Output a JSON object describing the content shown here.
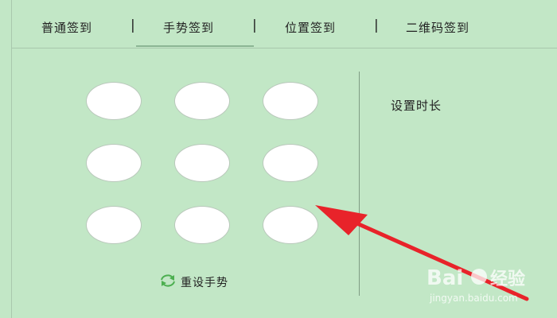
{
  "tabs": [
    {
      "label": "普通签到"
    },
    {
      "label": "手势签到",
      "active": true
    },
    {
      "label": "位置签到"
    },
    {
      "label": "二维码签到"
    }
  ],
  "separator": "|",
  "gesture_panel": {
    "reset_label": "重设手势",
    "reset_icon": "refresh-icon"
  },
  "duration_panel": {
    "label": "设置时长"
  },
  "annotation": {
    "arrow_color": "#e8232a"
  },
  "watermark": {
    "brand": "Baidu经验",
    "url": "jingyan.baidu.com"
  },
  "colors": {
    "background": "#c2e7c6",
    "active_tab_underline": "#8bb593",
    "dot_fill": "#ffffff"
  }
}
